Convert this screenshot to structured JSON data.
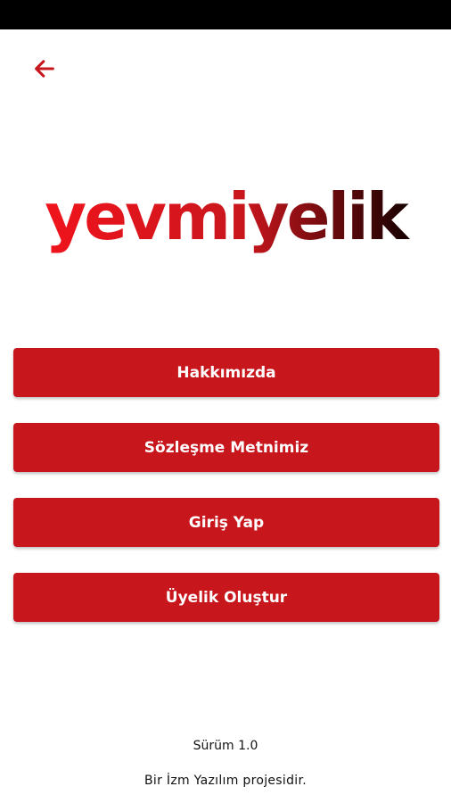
{
  "app": {
    "logo_text": "yevmiyelik"
  },
  "colors": {
    "accent": "#c8161d",
    "logo_gradient_start": "#e8141c",
    "logo_gradient_end": "#1a0000"
  },
  "icons": {
    "back": "back-arrow-icon"
  },
  "menu": {
    "items": [
      {
        "label": "Hakkımızda"
      },
      {
        "label": "Sözleşme Metnimiz"
      },
      {
        "label": "Giriş Yap"
      },
      {
        "label": "Üyelik Oluştur"
      }
    ]
  },
  "footer": {
    "version": "Sürüm 1.0",
    "credit": "Bir İzm Yazılım projesidir."
  }
}
